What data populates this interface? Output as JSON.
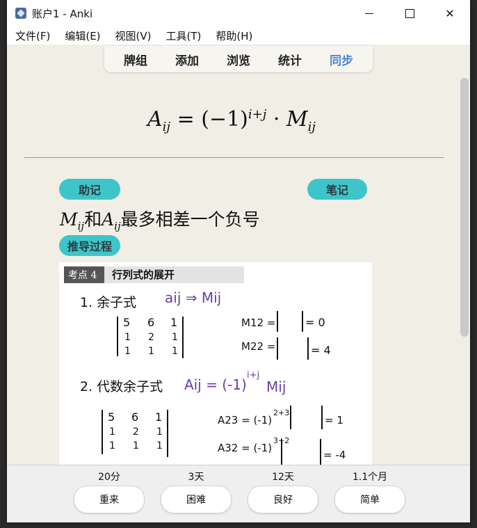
{
  "window": {
    "title": "账户1 - Anki"
  },
  "menu": [
    "文件(F)",
    "编辑(E)",
    "视图(V)",
    "工具(T)",
    "帮助(H)"
  ],
  "nav": [
    "牌组",
    "添加",
    "浏览",
    "统计",
    "同步"
  ],
  "card": {
    "fields": {
      "mnemonic": "助记",
      "notes": "笔记",
      "derivation": "推导过程"
    },
    "text_connector": "和",
    "text_tail": "最多相差一个负号",
    "figure": {
      "header_tag": "考点 4",
      "header_title": "行列式的展开",
      "item1_label": "1. 余子式",
      "item1_arrow": "aij ⇒ Mij",
      "item1_m12": "M12 =",
      "item1_m12_val": "= 0",
      "item1_m22": "M22 =",
      "item1_m22_val": "= 4",
      "item2_label": "2. 代数余子式",
      "item2_formula": "Aij = (-1)",
      "item2_formula_exp": "i+j",
      "item2_formula_tail": "Mij",
      "item2_a23": "A23 = (-1)",
      "item2_a23_exp": "2+3",
      "item2_a23_val": "= 1",
      "item2_a32": "A32 = (-1)",
      "item2_a32_exp": "3+2",
      "item2_a32_val": "= -4",
      "matrix1": [
        [
          "5",
          "6",
          "1"
        ],
        [
          "1",
          "2",
          "1"
        ],
        [
          "1",
          "1",
          "1"
        ]
      ]
    }
  },
  "answers": [
    {
      "interval": "20分",
      "label": "重来"
    },
    {
      "interval": "3天",
      "label": "困难"
    },
    {
      "interval": "12天",
      "label": "良好"
    },
    {
      "interval": "1.1个月",
      "label": "简单"
    }
  ],
  "colors": {
    "pill": "#3ec5c9",
    "sync": "#4a86d8",
    "ink_purple": "#6a3fa0"
  }
}
